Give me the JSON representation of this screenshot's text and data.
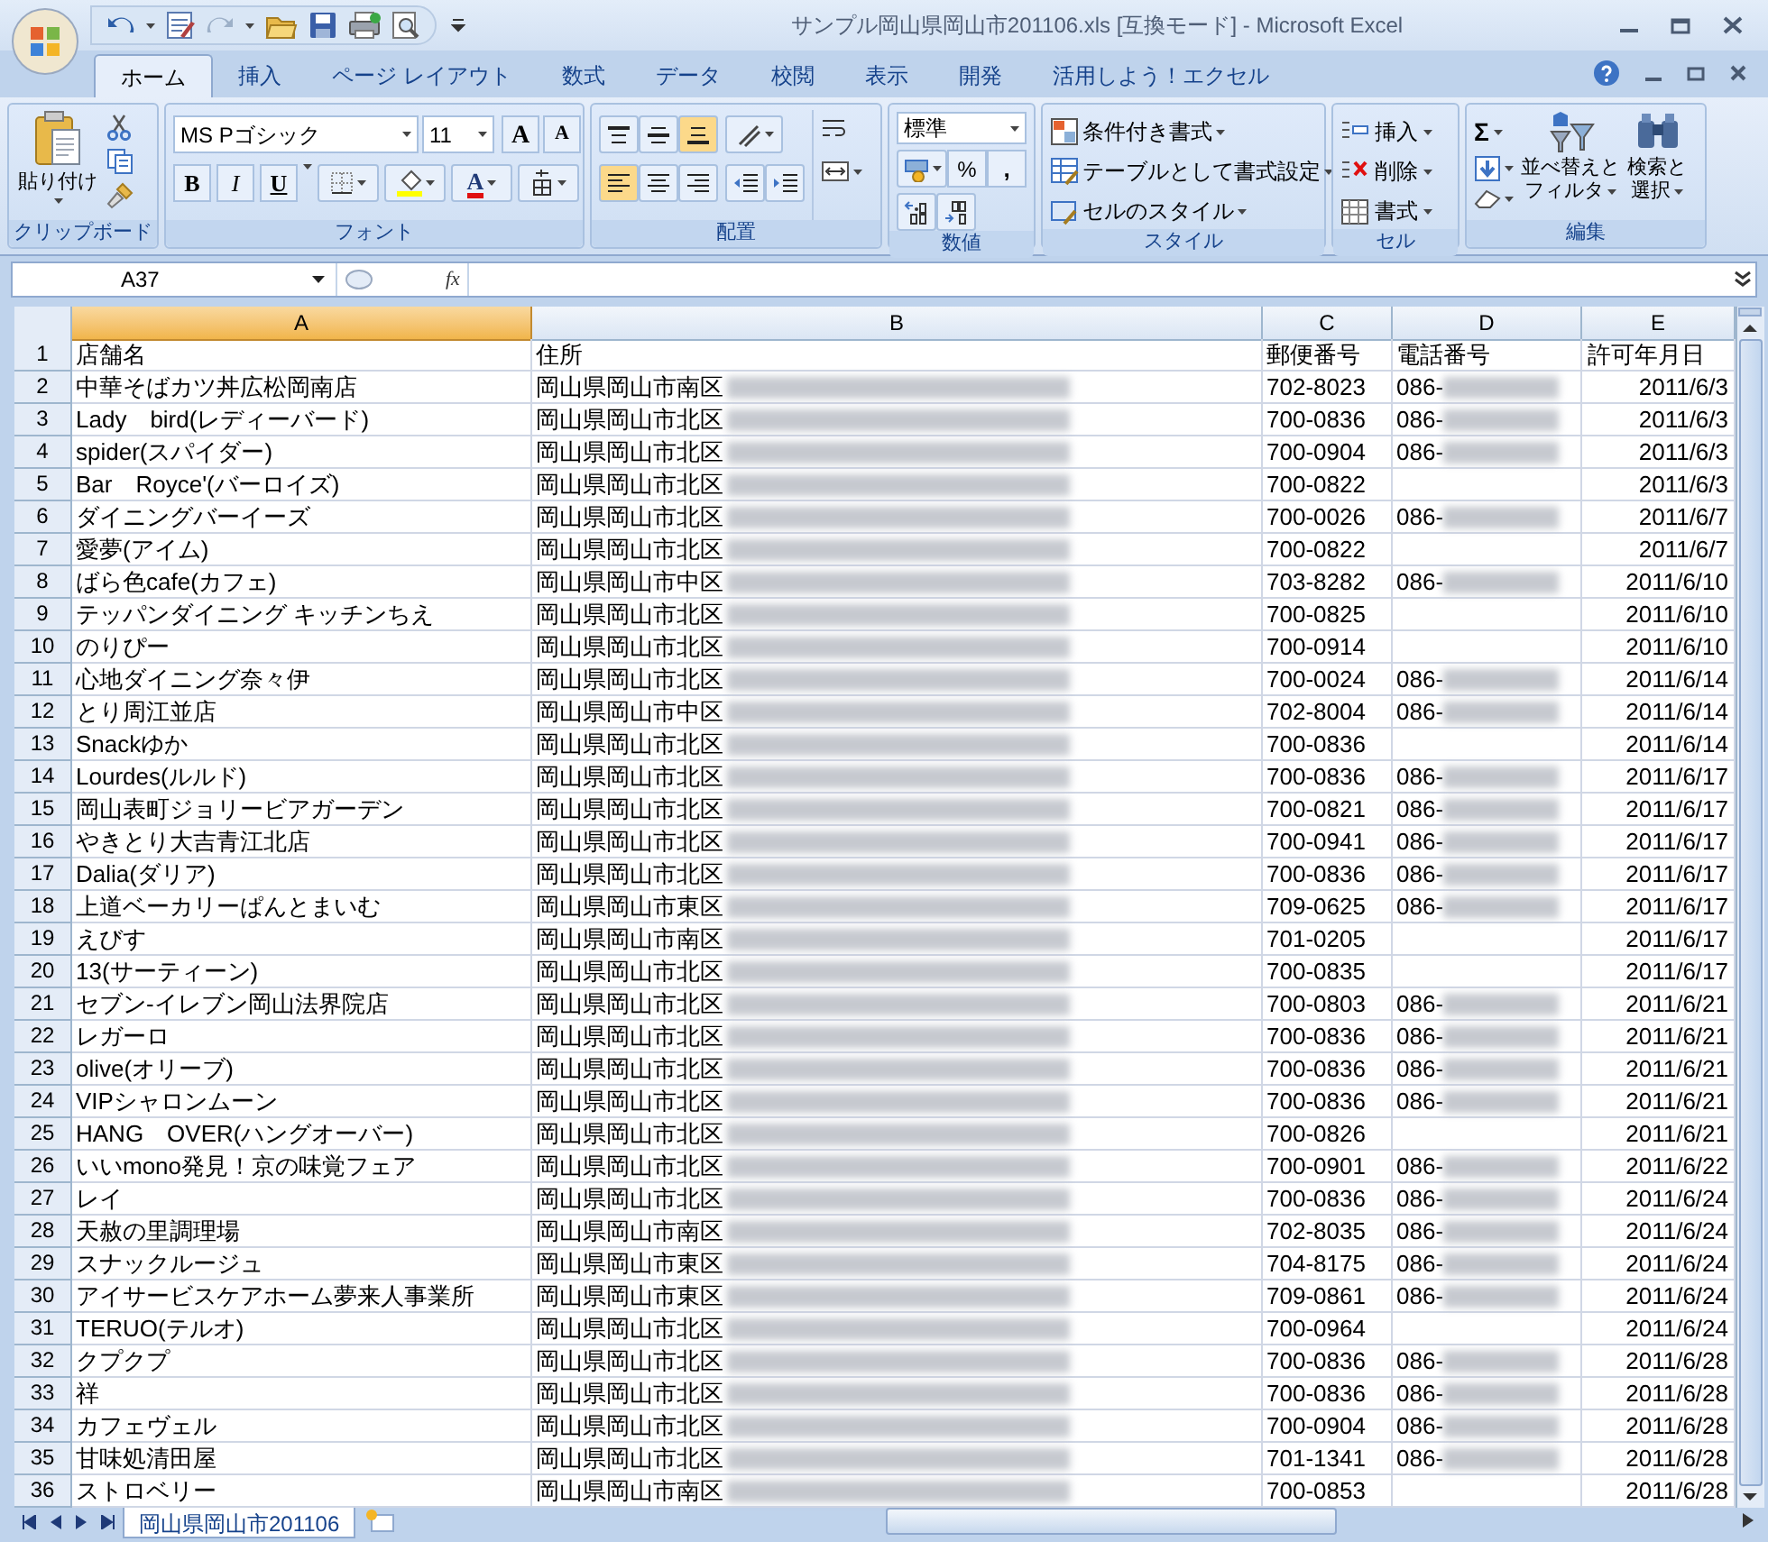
{
  "window": {
    "title": "サンプル岡山県岡山市201106.xls  [互換モード] - Microsoft Excel"
  },
  "tabs": [
    {
      "label": "ホーム",
      "selected": true
    },
    {
      "label": "挿入",
      "selected": false
    },
    {
      "label": "ページ レイアウト",
      "selected": false
    },
    {
      "label": "数式",
      "selected": false
    },
    {
      "label": "データ",
      "selected": false
    },
    {
      "label": "校閲",
      "selected": false
    },
    {
      "label": "表示",
      "selected": false
    },
    {
      "label": "開発",
      "selected": false
    },
    {
      "label": "活用しよう！エクセル",
      "selected": false
    }
  ],
  "ribbon": [
    {
      "kind": "clipboard",
      "label": "クリップボード",
      "paste": "貼り付け"
    },
    {
      "kind": "font",
      "label": "フォント",
      "font_name": "MS Pゴシック",
      "font_size": "11",
      "grow": "A",
      "shrink": "A",
      "bold": "B",
      "italic": "I",
      "underline": "U",
      "font_color": "A"
    },
    {
      "kind": "alignment",
      "label": "配置",
      "vertical": [
        {
          "selected": false
        },
        {
          "selected": false
        },
        {
          "selected": true
        }
      ],
      "horizontal": [
        {
          "selected": true
        },
        {
          "selected": false
        },
        {
          "selected": false
        }
      ]
    },
    {
      "kind": "number",
      "label": "数値",
      "format": "標準",
      "percent": "%",
      "comma": ","
    },
    {
      "kind": "styles",
      "label": "スタイル",
      "items": [
        "条件付き書式",
        "テーブルとして書式設定",
        "セルのスタイル"
      ]
    },
    {
      "kind": "cells",
      "label": "セル",
      "items": [
        "挿入",
        "削除",
        "書式"
      ]
    },
    {
      "kind": "editing",
      "label": "編集",
      "sum": "Σ",
      "big": [
        [
          "並べ替えと",
          "フィルタ"
        ],
        [
          "検索と",
          "選択"
        ]
      ]
    }
  ],
  "formula_bar": {
    "name_box": "A37",
    "fx": "fx"
  },
  "columns": [
    {
      "label": "A",
      "selected": true
    },
    {
      "label": "B",
      "selected": false
    },
    {
      "label": "C",
      "selected": false
    },
    {
      "label": "D",
      "selected": false
    },
    {
      "label": "E",
      "selected": false
    }
  ],
  "rows": [
    {
      "num": "1",
      "name": "店舗名",
      "address": "住所",
      "redacted": false,
      "postal": "郵便番号",
      "phone": "電話番号",
      "phone_redacted": false,
      "date": "許可年月日",
      "header": true
    },
    {
      "num": "2",
      "name": "中華そばカツ丼広松岡南店",
      "address": "岡山県岡山市南区",
      "redacted": true,
      "postal": "702-8023",
      "phone": "086-",
      "phone_redacted": true,
      "date": "2011/6/3",
      "header": false
    },
    {
      "num": "3",
      "name": "Lady　bird(レディーバード)",
      "address": "岡山県岡山市北区",
      "redacted": true,
      "postal": "700-0836",
      "phone": "086-",
      "phone_redacted": true,
      "date": "2011/6/3",
      "header": false
    },
    {
      "num": "4",
      "name": "spider(スパイダー)",
      "address": "岡山県岡山市北区",
      "redacted": true,
      "postal": "700-0904",
      "phone": "086-",
      "phone_redacted": true,
      "date": "2011/6/3",
      "header": false
    },
    {
      "num": "5",
      "name": "Bar　Royce'(バーロイズ)",
      "address": "岡山県岡山市北区",
      "redacted": true,
      "postal": "700-0822",
      "phone_redacted": false,
      "date": "2011/6/3",
      "header": false
    },
    {
      "num": "6",
      "name": "ダイニングバーイーズ",
      "address": "岡山県岡山市北区",
      "redacted": true,
      "postal": "700-0026",
      "phone": "086-",
      "phone_redacted": true,
      "date": "2011/6/7",
      "header": false
    },
    {
      "num": "7",
      "name": "愛夢(アイム)",
      "address": "岡山県岡山市北区",
      "redacted": true,
      "postal": "700-0822",
      "phone_redacted": false,
      "date": "2011/6/7",
      "header": false
    },
    {
      "num": "8",
      "name": "ばら色cafe(カフェ)",
      "address": "岡山県岡山市中区",
      "redacted": true,
      "postal": "703-8282",
      "phone": "086-",
      "phone_redacted": true,
      "date": "2011/6/10",
      "header": false
    },
    {
      "num": "9",
      "name": "テッパンダイニング キッチンちえ",
      "address": "岡山県岡山市北区",
      "redacted": true,
      "postal": "700-0825",
      "phone_redacted": false,
      "date": "2011/6/10",
      "header": false
    },
    {
      "num": "10",
      "name": "のりぴー",
      "address": "岡山県岡山市北区",
      "redacted": true,
      "postal": "700-0914",
      "phone_redacted": false,
      "date": "2011/6/10",
      "header": false
    },
    {
      "num": "11",
      "name": "心地ダイニング奈々伊",
      "address": "岡山県岡山市北区",
      "redacted": true,
      "postal": "700-0024",
      "phone": "086-",
      "phone_redacted": true,
      "date": "2011/6/14",
      "header": false
    },
    {
      "num": "12",
      "name": "とり周江並店",
      "address": "岡山県岡山市中区",
      "redacted": true,
      "postal": "702-8004",
      "phone": "086-",
      "phone_redacted": true,
      "date": "2011/6/14",
      "header": false
    },
    {
      "num": "13",
      "name": "Snackゆか",
      "address": "岡山県岡山市北区",
      "redacted": true,
      "postal": "700-0836",
      "phone_redacted": false,
      "date": "2011/6/14",
      "header": false
    },
    {
      "num": "14",
      "name": "Lourdes(ルルド)",
      "address": "岡山県岡山市北区",
      "redacted": true,
      "postal": "700-0836",
      "phone": "086-",
      "phone_redacted": true,
      "date": "2011/6/17",
      "header": false
    },
    {
      "num": "15",
      "name": "岡山表町ジョリービアガーデン",
      "address": "岡山県岡山市北区",
      "redacted": true,
      "postal": "700-0821",
      "phone": "086-",
      "phone_redacted": true,
      "date": "2011/6/17",
      "header": false
    },
    {
      "num": "16",
      "name": "やきとり大吉青江北店",
      "address": "岡山県岡山市北区",
      "redacted": true,
      "postal": "700-0941",
      "phone": "086-",
      "phone_redacted": true,
      "date": "2011/6/17",
      "header": false
    },
    {
      "num": "17",
      "name": "Dalia(ダリア)",
      "address": "岡山県岡山市北区",
      "redacted": true,
      "postal": "700-0836",
      "phone": "086-",
      "phone_redacted": true,
      "date": "2011/6/17",
      "header": false
    },
    {
      "num": "18",
      "name": "上道ベーカリーぱんとまいむ",
      "address": "岡山県岡山市東区",
      "redacted": true,
      "postal": "709-0625",
      "phone": "086-",
      "phone_redacted": true,
      "date": "2011/6/17",
      "header": false
    },
    {
      "num": "19",
      "name": "えびす",
      "address": "岡山県岡山市南区",
      "redacted": true,
      "postal": "701-0205",
      "phone_redacted": false,
      "date": "2011/6/17",
      "header": false
    },
    {
      "num": "20",
      "name": "13(サーティーン)",
      "address": "岡山県岡山市北区",
      "redacted": true,
      "postal": "700-0835",
      "phone_redacted": false,
      "date": "2011/6/17",
      "header": false
    },
    {
      "num": "21",
      "name": "セブン-イレブン岡山法界院店",
      "address": "岡山県岡山市北区",
      "redacted": true,
      "postal": "700-0803",
      "phone": "086-",
      "phone_redacted": true,
      "date": "2011/6/21",
      "header": false
    },
    {
      "num": "22",
      "name": "レガーロ",
      "address": "岡山県岡山市北区",
      "redacted": true,
      "postal": "700-0836",
      "phone": "086-",
      "phone_redacted": true,
      "date": "2011/6/21",
      "header": false
    },
    {
      "num": "23",
      "name": "olive(オリーブ)",
      "address": "岡山県岡山市北区",
      "redacted": true,
      "postal": "700-0836",
      "phone": "086-",
      "phone_redacted": true,
      "date": "2011/6/21",
      "header": false
    },
    {
      "num": "24",
      "name": "VIPシャロンムーン",
      "address": "岡山県岡山市北区",
      "redacted": true,
      "postal": "700-0836",
      "phone": "086-",
      "phone_redacted": true,
      "date": "2011/6/21",
      "header": false
    },
    {
      "num": "25",
      "name": "HANG　OVER(ハングオーバー)",
      "address": "岡山県岡山市北区",
      "redacted": true,
      "postal": "700-0826",
      "phone_redacted": false,
      "date": "2011/6/21",
      "header": false
    },
    {
      "num": "26",
      "name": "いいmono発見！京の味覚フェア",
      "address": "岡山県岡山市北区",
      "redacted": true,
      "postal": "700-0901",
      "phone": "086-",
      "phone_redacted": true,
      "date": "2011/6/22",
      "header": false
    },
    {
      "num": "27",
      "name": "レイ",
      "address": "岡山県岡山市北区",
      "redacted": true,
      "postal": "700-0836",
      "phone": "086-",
      "phone_redacted": true,
      "date": "2011/6/24",
      "header": false
    },
    {
      "num": "28",
      "name": "天赦の里調理場",
      "address": "岡山県岡山市南区",
      "redacted": true,
      "postal": "702-8035",
      "phone": "086-",
      "phone_redacted": true,
      "date": "2011/6/24",
      "header": false
    },
    {
      "num": "29",
      "name": "スナックルージュ",
      "address": "岡山県岡山市東区",
      "redacted": true,
      "postal": "704-8175",
      "phone": "086-",
      "phone_redacted": true,
      "date": "2011/6/24",
      "header": false
    },
    {
      "num": "30",
      "name": "アイサービスケアホーム夢来人事業所",
      "address": "岡山県岡山市東区",
      "redacted": true,
      "postal": "709-0861",
      "phone": "086-",
      "phone_redacted": true,
      "date": "2011/6/24",
      "header": false
    },
    {
      "num": "31",
      "name": "TERUO(テルオ)",
      "address": "岡山県岡山市北区",
      "redacted": true,
      "postal": "700-0964",
      "phone_redacted": false,
      "date": "2011/6/24",
      "header": false
    },
    {
      "num": "32",
      "name": "クプクプ",
      "address": "岡山県岡山市北区",
      "redacted": true,
      "postal": "700-0836",
      "phone": "086-",
      "phone_redacted": true,
      "date": "2011/6/28",
      "header": false
    },
    {
      "num": "33",
      "name": "祥",
      "address": "岡山県岡山市北区",
      "redacted": true,
      "postal": "700-0836",
      "phone": "086-",
      "phone_redacted": true,
      "date": "2011/6/28",
      "header": false
    },
    {
      "num": "34",
      "name": "カフェヴェル",
      "address": "岡山県岡山市北区",
      "redacted": true,
      "postal": "700-0904",
      "phone": "086-",
      "phone_redacted": true,
      "date": "2011/6/28",
      "header": false
    },
    {
      "num": "35",
      "name": "甘味処清田屋",
      "address": "岡山県岡山市北区",
      "redacted": true,
      "postal": "701-1341",
      "phone": "086-",
      "phone_redacted": true,
      "date": "2011/6/28",
      "header": false
    },
    {
      "num": "36",
      "name": "ストロベリー",
      "address": "岡山県岡山市南区",
      "redacted": true,
      "postal": "700-0853",
      "phone_redacted": false,
      "date": "2011/6/28",
      "header": false
    }
  ],
  "sheet_tabs": [
    {
      "label": "岡山県岡山市201106",
      "selected": true
    }
  ]
}
